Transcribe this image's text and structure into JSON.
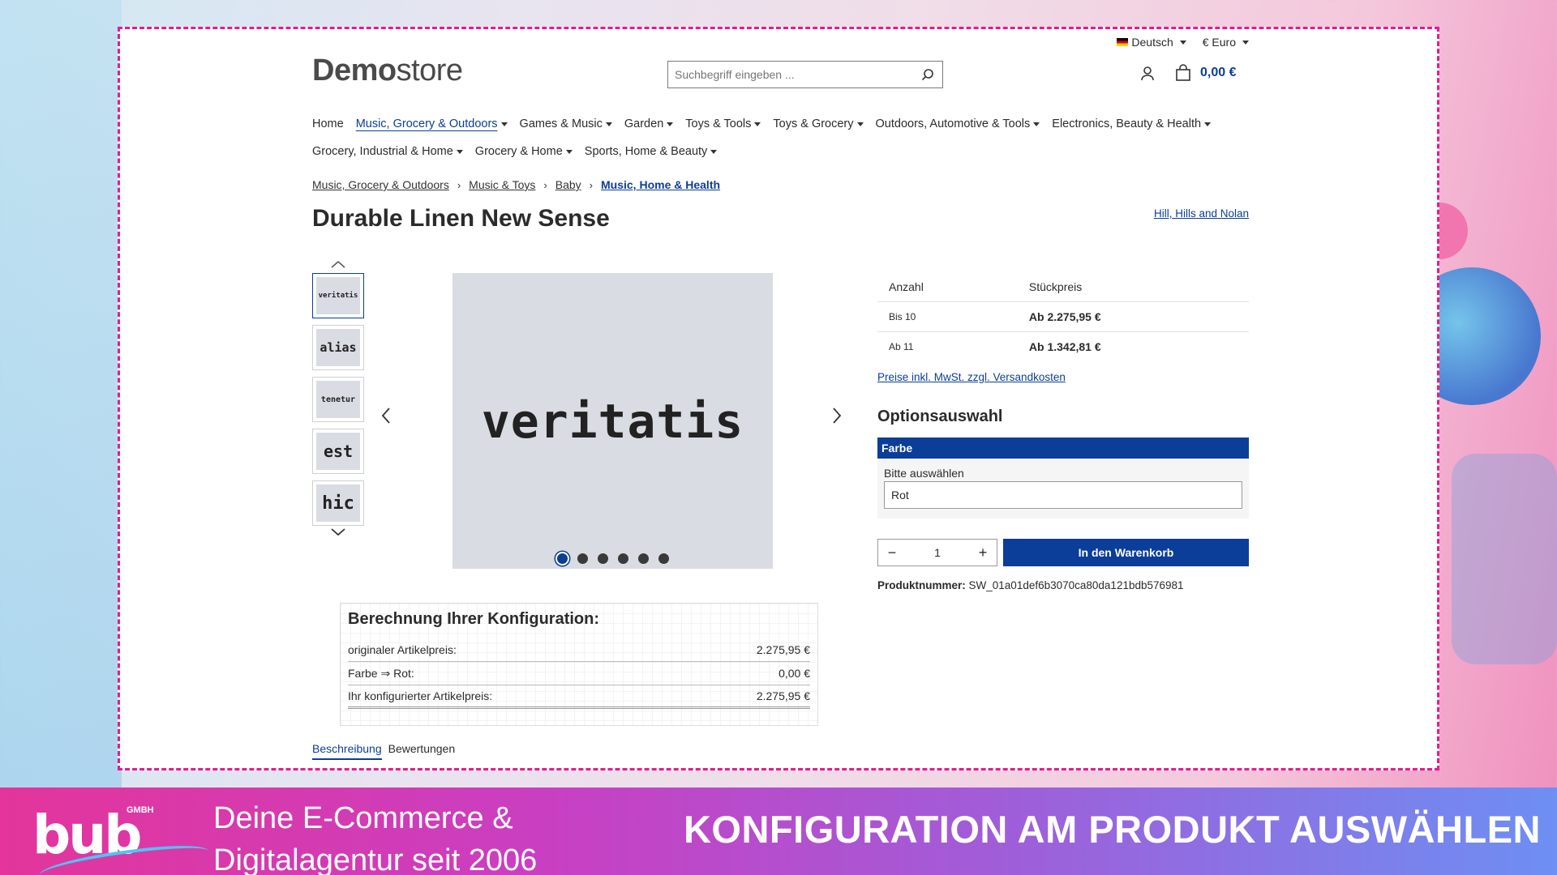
{
  "topbar": {
    "language": "Deutsch",
    "currency": "€ Euro"
  },
  "logo": {
    "bold": "Demo",
    "light": "store"
  },
  "search": {
    "placeholder": "Suchbegriff eingeben ..."
  },
  "cart": {
    "total": "0,00 €"
  },
  "nav": {
    "row1": [
      {
        "label": "Home",
        "dropdown": false,
        "active": false
      },
      {
        "label": "Music, Grocery & Outdoors",
        "dropdown": true,
        "active": true
      },
      {
        "label": "Games & Music",
        "dropdown": true,
        "active": false
      },
      {
        "label": "Garden",
        "dropdown": true,
        "active": false
      },
      {
        "label": "Toys & Tools",
        "dropdown": true,
        "active": false
      },
      {
        "label": "Toys & Grocery",
        "dropdown": true,
        "active": false
      },
      {
        "label": "Outdoors, Automotive & Tools",
        "dropdown": true,
        "active": false
      },
      {
        "label": "Electronics, Beauty & Health",
        "dropdown": true,
        "active": false
      }
    ],
    "row2": [
      {
        "label": "Grocery, Industrial & Home",
        "dropdown": true,
        "active": false
      },
      {
        "label": "Grocery & Home",
        "dropdown": true,
        "active": false
      },
      {
        "label": "Sports, Home & Beauty",
        "dropdown": true,
        "active": false
      }
    ]
  },
  "breadcrumb": [
    "Music, Grocery & Outdoors",
    "Music & Toys",
    "Baby",
    "Music, Home & Health"
  ],
  "product": {
    "title": "Durable Linen New Sense",
    "manufacturer": "Hill, Hills and Nolan",
    "main_image_word": "veritatis",
    "thumbnails": [
      "veritatis",
      "alias",
      "tenetur",
      "est",
      "hic"
    ],
    "slide_count": 6,
    "active_slide": 0
  },
  "calculation": {
    "title": "Berechnung Ihrer Konfiguration:",
    "rows": [
      {
        "label": "originaler Artikelpreis:",
        "value": "2.275,95 €"
      },
      {
        "label": "Farbe ⇒ Rot:",
        "value": "0,00 €"
      },
      {
        "label": "Ihr konfigurierter Artikelpreis:",
        "value": "2.275,95 €"
      }
    ]
  },
  "tabs": [
    "Beschreibung",
    "Bewertungen"
  ],
  "pricing": {
    "col_qty": "Anzahl",
    "col_price": "Stückpreis",
    "rows": [
      {
        "qty": "Bis 10",
        "price": "Ab 2.275,95 €"
      },
      {
        "qty": "Ab 11",
        "price": "Ab 1.342,81 €"
      }
    ],
    "tax_note": "Preise inkl. MwSt. zzgl. Versandkosten"
  },
  "options": {
    "title": "Optionsauswahl",
    "group": "Farbe",
    "label": "Bitte auswählen",
    "selected": "Rot"
  },
  "buy": {
    "quantity": "1",
    "button": "In den Warenkorb"
  },
  "sku": {
    "label": "Produktnummer:",
    "value": "SW_01a01def6b3070ca80da121bdb576981"
  },
  "banner": {
    "logo_text": "bub",
    "logo_suffix": "GMBH",
    "tagline_line1": "Deine E-Commerce &",
    "tagline_line2": "Digitalagentur seit 2006",
    "headline": "KONFIGURATION AM PRODUKT AUSWÄHLEN"
  },
  "colors": {
    "accent": "#0b3e99",
    "frame": "#e21b97"
  }
}
